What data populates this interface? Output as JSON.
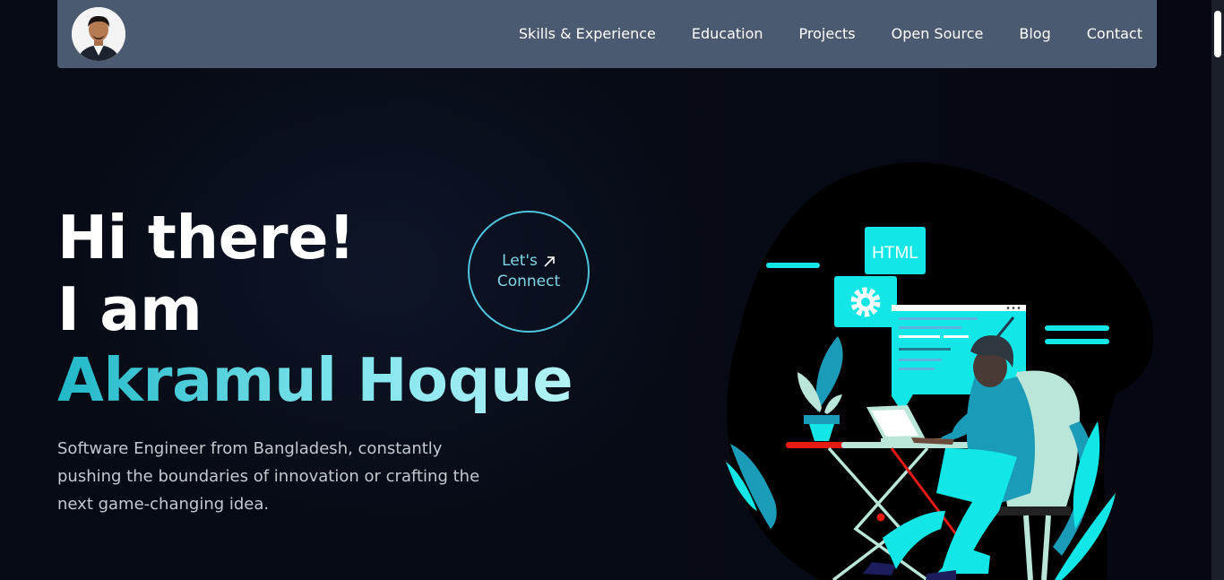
{
  "nav": {
    "avatar_alt": "Profile photo",
    "links": [
      "Skills & Experience",
      "Education",
      "Projects",
      "Open Source",
      "Blog",
      "Contact"
    ]
  },
  "hero": {
    "greeting": "Hi there!",
    "intro": "I am",
    "name": "Akramul Hoque",
    "description": "Software Engineer from Bangladesh, constantly pushing the boundaries of innovation or crafting the next game-changing idea.",
    "cta_line1": "Let's",
    "cta_line2": "Connect",
    "cta_icon": "arrow-up-right-icon"
  },
  "illustration": {
    "badge_text": "HTML",
    "icons": [
      "gear-icon",
      "laptop-icon",
      "code-window-icon"
    ]
  },
  "colors": {
    "navbar_bg": "#4b5a70",
    "background": "#050812",
    "accent": "#12e6e6",
    "name_gradient_start": "#21b8c8",
    "name_gradient_end": "#b3f2f5"
  }
}
